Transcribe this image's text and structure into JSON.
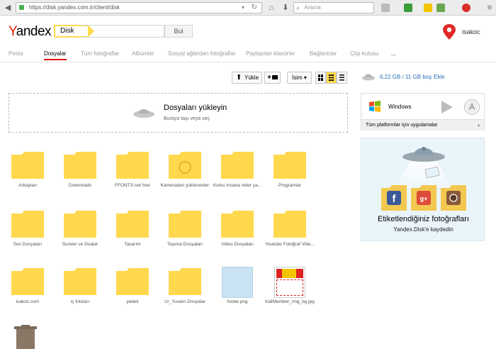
{
  "browser": {
    "url": "https://disk.yandex.com.tr/client/disk",
    "search_placeholder": "Arama"
  },
  "header": {
    "logo": "Yandex",
    "service_label": "Disk",
    "search_button": "Bul",
    "username": "isakoc"
  },
  "tabs": [
    {
      "label": "Posta"
    },
    {
      "label": "Dosyalar"
    },
    {
      "label": "Tüm fotoğraflar"
    },
    {
      "label": "Albümler"
    },
    {
      "label": "Sosyal ağlardan fotoğraflar"
    },
    {
      "label": "Paylaşılan klasörler"
    },
    {
      "label": "Bağlantılar"
    },
    {
      "label": "Çöp kutusu"
    },
    {
      "label": "..."
    }
  ],
  "active_tab": "Dosyalar",
  "toolbar": {
    "upload_label": "Yükle",
    "new_folder_label": "+",
    "sort_label": "İsim"
  },
  "dropzone": {
    "title": "Dosyaları yükleyin",
    "subtitle": "Buraya taşı veya seç"
  },
  "files": [
    {
      "name": "Arkaplan",
      "type": "folder"
    },
    {
      "name": "Downloads",
      "type": "folder"
    },
    {
      "name": "FFONTS.net free",
      "type": "folder"
    },
    {
      "name": "Kameradan yüklenenler",
      "type": "folder-camera"
    },
    {
      "name": "Korku insana neler ya...",
      "type": "folder"
    },
    {
      "name": "Programlar",
      "type": "folder"
    },
    {
      "name": "Ses Dosyaları",
      "type": "folder"
    },
    {
      "name": "Sureler ve Dualar",
      "type": "folder"
    },
    {
      "name": "Tasarım",
      "type": "folder"
    },
    {
      "name": "Taşıma Dosyaları",
      "type": "folder"
    },
    {
      "name": "Video Dosyaları",
      "type": "folder"
    },
    {
      "name": "Youtube Fotoğraf Vide...",
      "type": "folder"
    },
    {
      "name": "isakoc.com",
      "type": "folder"
    },
    {
      "name": "iş fotoları",
      "type": "folder"
    },
    {
      "name": "yedek",
      "type": "folder"
    },
    {
      "name": "zz_Yuvarn Dosyalar",
      "type": "folder"
    },
    {
      "name": "footer.png",
      "type": "image"
    },
    {
      "name": "trailMember_img_bg.jpg",
      "type": "image-banner"
    }
  ],
  "sidebar": {
    "quota_text": "6,22 GB / 11 GB boş",
    "quota_link": "Ekle",
    "windows_label": "Windows",
    "apps_link": "Tüm platformlar için uygulamalar",
    "promo_title": "Etiketlendiğiniz fotoğrafları",
    "promo_subtitle": "Yandex.Disk'e kaydedin"
  },
  "colors": {
    "folder": "#ffd84d",
    "accent_red": "#e61400",
    "accent_yellow": "#ffdb4d",
    "link_blue": "#2c6fb7"
  }
}
